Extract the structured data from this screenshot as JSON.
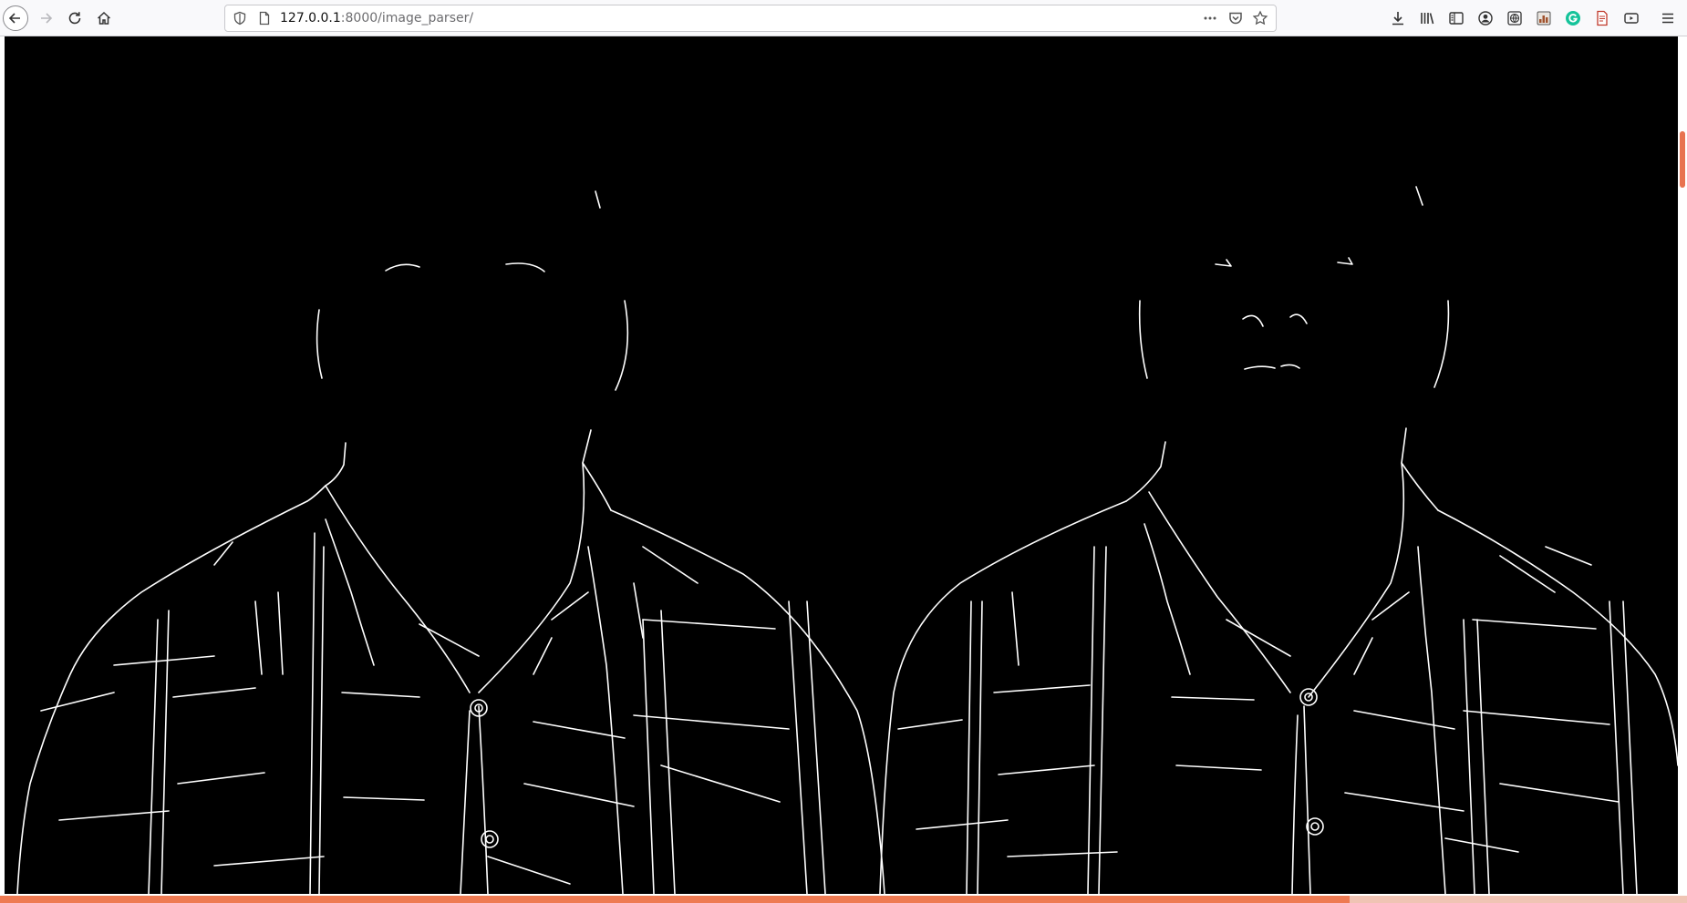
{
  "browser": {
    "url_host": "127.0.0.1",
    "url_rest": ":8000/image_parser/",
    "icons": {
      "back": "back-arrow-icon",
      "forward": "forward-arrow-icon",
      "reload": "reload-icon",
      "home": "home-icon",
      "tracking": "shield-icon",
      "page": "page-icon",
      "page_actions": "more-icon",
      "pocket": "pocket-icon",
      "bookmark": "star-icon",
      "downloads": "download-icon",
      "library": "library-icon",
      "sidebar": "sidebar-icon",
      "account": "account-icon",
      "extension_1": "globe-icon",
      "extension_2": "chart-icon",
      "extension_3": "grammarly-icon",
      "extension_4": "pdf-icon",
      "extension_5": "media-icon",
      "menu": "hamburger-menu-icon"
    }
  },
  "page": {
    "content": "edge-detected image (white outlines on black) of two figures side by side",
    "accent_color": "#ee7a52",
    "load_progress_percent": 80
  }
}
